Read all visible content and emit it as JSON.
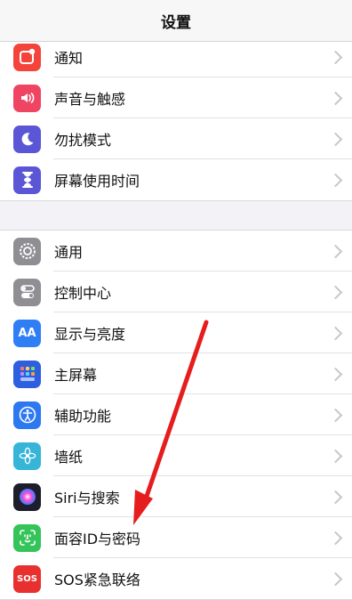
{
  "header": {
    "title": "设置"
  },
  "group1": [
    {
      "label": "通知",
      "icon": "notifications-icon",
      "color": "#f4433b"
    },
    {
      "label": "声音与触感",
      "icon": "sound-icon",
      "color": "#f04463"
    },
    {
      "label": "勿扰模式",
      "icon": "moon-icon",
      "color": "#5b56d6"
    },
    {
      "label": "屏幕使用时间",
      "icon": "hourglass-icon",
      "color": "#5b56d6"
    }
  ],
  "group2": [
    {
      "label": "通用",
      "icon": "gear-icon",
      "color": "#8e8e93"
    },
    {
      "label": "控制中心",
      "icon": "toggle-icon",
      "color": "#8e8e93"
    },
    {
      "label": "显示与亮度",
      "icon": "text-size-icon",
      "color": "#2f7ef5",
      "glyph": "AA"
    },
    {
      "label": "主屏幕",
      "icon": "home-screen-icon",
      "color": "#2d5fde"
    },
    {
      "label": "辅助功能",
      "icon": "accessibility-icon",
      "color": "#2c78f1"
    },
    {
      "label": "墙纸",
      "icon": "flower-icon",
      "color": "#36b5d9"
    },
    {
      "label": "Siri与搜索",
      "icon": "siri-icon",
      "color": "#1d1d2b"
    },
    {
      "label": "面容ID与密码",
      "icon": "face-id-icon",
      "color": "#35c45a"
    },
    {
      "label": "SOS紧急联络",
      "icon": "sos-icon",
      "color": "#e8302f",
      "glyph": "SOS"
    }
  ]
}
